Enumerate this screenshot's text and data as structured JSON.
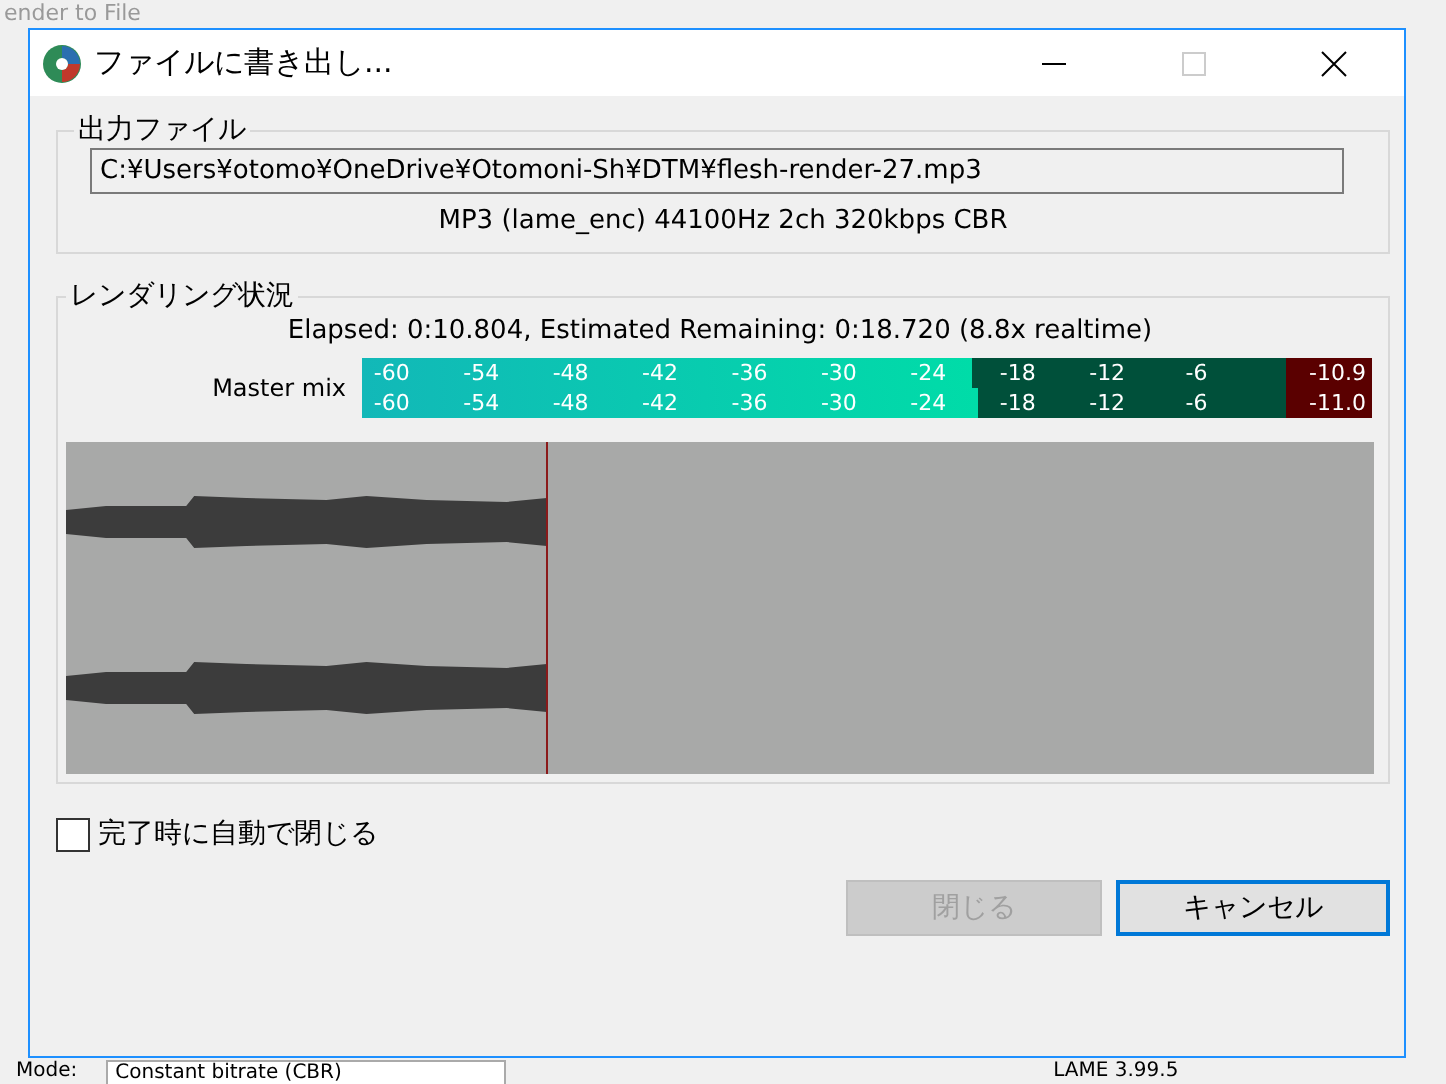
{
  "background_window": {
    "title": "ender to File",
    "mode_label": "Mode:",
    "mode_value": "Constant bitrate (CBR)",
    "encoder": "LAME 3.99.5"
  },
  "window": {
    "title": "ファイルに書き出し..."
  },
  "output_group": {
    "title": "出力ファイル",
    "path": "C:¥Users¥otomo¥OneDrive¥Otomoni-Sh¥DTM¥flesh-render-27.mp3",
    "format": "MP3 (lame_enc) 44100Hz 2ch 320kbps CBR"
  },
  "render_group": {
    "title": "レンダリング状況",
    "status": "Elapsed: 0:10.804, Estimated Remaining: 0:18.720 (8.8x realtime)",
    "meter_label": "Master mix",
    "channels": [
      {
        "level": 0.66,
        "reading": "-10.9",
        "scale": [
          "-60",
          "-54",
          "-48",
          "-42",
          "-36",
          "-30",
          "-24",
          "-18",
          "-12",
          "-6"
        ]
      },
      {
        "level": 0.667,
        "reading": "-11.0",
        "scale": [
          "-60",
          "-54",
          "-48",
          "-42",
          "-36",
          "-30",
          "-24",
          "-18",
          "-12",
          "-6"
        ]
      }
    ],
    "progress": {
      "level": 0.367
    }
  },
  "auto_close": {
    "label": "完了時に自動で閉じる",
    "checked": false
  },
  "buttons": [
    {
      "label": "閉じる",
      "disabled": true
    },
    {
      "label": "キャンセル",
      "disabled": false
    }
  ]
}
